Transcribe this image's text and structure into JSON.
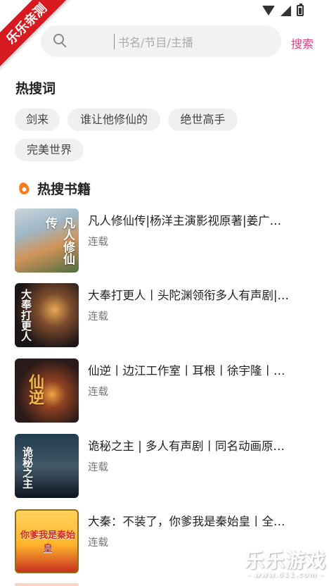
{
  "status": {
    "wifi_icon": "wifi-icon",
    "signal_icon": "signal-icon",
    "battery_icon": "battery-icon"
  },
  "ribbon": {
    "label": "乐乐亲测"
  },
  "search": {
    "placeholder": "书名/节目/主播",
    "button_label": "搜索",
    "accent": "#e1417d"
  },
  "hot_words": {
    "title": "热搜词",
    "items": [
      "剑来",
      "谁让他修仙的",
      "绝世高手",
      "完美世界"
    ]
  },
  "hot_books": {
    "title": "热搜书籍",
    "items": [
      {
        "title": "凡人修仙传|杨洋主演影视原著|姜广…",
        "status": "连载"
      },
      {
        "title": "大奉打更人丨头陀渊领衔多人有声剧|…",
        "status": "连载"
      },
      {
        "title": "仙逆丨边江工作室丨耳根丨徐宇隆丨…",
        "status": "连载"
      },
      {
        "title": "诡秘之主 | 多人有声剧丨同名动画原…",
        "status": "连载"
      },
      {
        "title": "大秦：不装了，你爹我是秦始皇丨全…",
        "status": "连载"
      }
    ]
  },
  "covers": {
    "c1": "凡人修仙传",
    "c2": "大奉打更人",
    "c3": "仙逆",
    "c4": "诡秘之主",
    "c5": "你爹我是秦始皇"
  },
  "watermark": {
    "main": "乐乐游戏",
    "sub": "- www.611.com -"
  }
}
